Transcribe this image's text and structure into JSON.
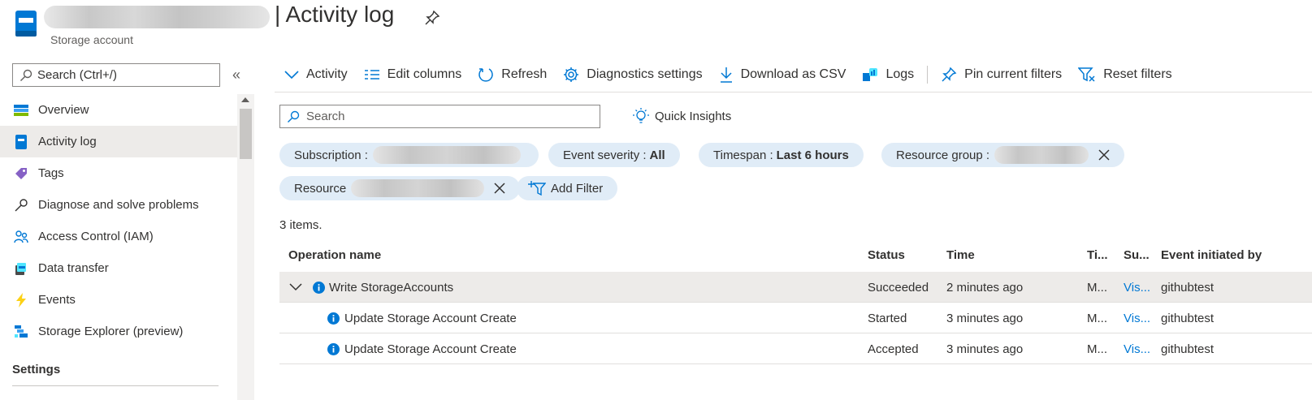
{
  "header": {
    "title": "| Activity log",
    "resource_type": "Storage account"
  },
  "sidebar": {
    "search_placeholder": "Search (Ctrl+/)",
    "collapse_glyph": "«",
    "items": [
      {
        "label": "Overview",
        "icon": "overview-icon"
      },
      {
        "label": "Activity log",
        "icon": "activity-log-icon",
        "active": true
      },
      {
        "label": "Tags",
        "icon": "tag-icon"
      },
      {
        "label": "Diagnose and solve problems",
        "icon": "wrench-icon"
      },
      {
        "label": "Access Control (IAM)",
        "icon": "people-icon"
      },
      {
        "label": "Data transfer",
        "icon": "data-transfer-icon"
      },
      {
        "label": "Events",
        "icon": "lightning-icon"
      },
      {
        "label": "Storage Explorer (preview)",
        "icon": "storage-explorer-icon"
      }
    ],
    "section_heading": "Settings"
  },
  "toolbar": {
    "activity": "Activity",
    "edit_columns": "Edit columns",
    "refresh": "Refresh",
    "diagnostics": "Diagnostics settings",
    "download": "Download as CSV",
    "logs": "Logs",
    "pin_filters": "Pin current filters",
    "reset_filters": "Reset filters"
  },
  "search": {
    "placeholder": "Search"
  },
  "quick_insights": "Quick Insights",
  "filters": {
    "subscription": {
      "label": "Subscription :"
    },
    "event_severity": {
      "label": "Event severity :",
      "value": "All"
    },
    "timespan": {
      "label": "Timespan :",
      "value": "Last 6 hours"
    },
    "resource_group": {
      "label": "Resource group :"
    },
    "resource": {
      "label": "Resource"
    },
    "add_filter": "Add Filter"
  },
  "results": {
    "count_text": "3 items."
  },
  "table": {
    "headers": {
      "operation": "Operation name",
      "status": "Status",
      "time": "Time",
      "timestamp": "Ti...",
      "subscription": "Su...",
      "initiated_by": "Event initiated by"
    },
    "rows": [
      {
        "operation": "Write StorageAccounts",
        "status": "Succeeded",
        "time": "2 minutes ago",
        "timestamp": "M...",
        "subscription": "Vis...",
        "initiated_by": "githubtest"
      },
      {
        "operation": "Update Storage Account Create",
        "status": "Started",
        "time": "3 minutes ago",
        "timestamp": "M...",
        "subscription": "Vis...",
        "initiated_by": "githubtest"
      },
      {
        "operation": "Update Storage Account Create",
        "status": "Accepted",
        "time": "3 minutes ago",
        "timestamp": "M...",
        "subscription": "Vis...",
        "initiated_by": "githubtest"
      }
    ]
  },
  "colors": {
    "accent": "#0078d4",
    "pill_bg": "#e0ecf7",
    "selected_row": "#edebe9"
  }
}
